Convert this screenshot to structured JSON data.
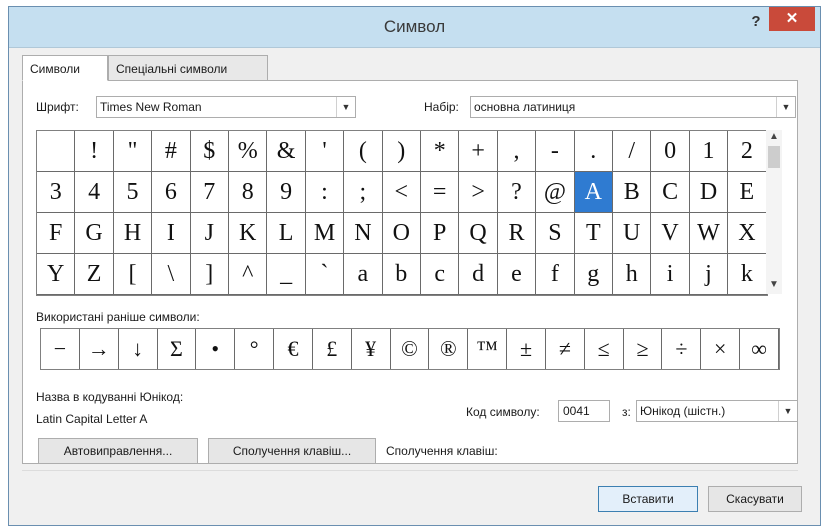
{
  "window": {
    "title": "Символ",
    "help_label": "?",
    "close_label": "✕"
  },
  "tabs": [
    {
      "label": "Символи",
      "active": true
    },
    {
      "label": "Спеціальні символи",
      "active": false
    }
  ],
  "font": {
    "label": "Шрифт:",
    "value": "Times New Roman"
  },
  "subset": {
    "label": "Набір:",
    "value": "основна латиниця"
  },
  "symbol_grid": {
    "rows": [
      [
        " ",
        "!",
        "\"",
        "#",
        "$",
        "%",
        "&",
        "'",
        "(",
        ")",
        "*",
        "+",
        ",",
        "-",
        ".",
        "/",
        "0",
        "1",
        "2"
      ],
      [
        "3",
        "4",
        "5",
        "6",
        "7",
        "8",
        "9",
        ":",
        ";",
        "<",
        "=",
        ">",
        "?",
        "@",
        "A",
        "B",
        "C",
        "D",
        "E"
      ],
      [
        "F",
        "G",
        "H",
        "I",
        "J",
        "K",
        "L",
        "M",
        "N",
        "O",
        "P",
        "Q",
        "R",
        "S",
        "T",
        "U",
        "V",
        "W",
        "X"
      ],
      [
        "Y",
        "Z",
        "[",
        "\\",
        "]",
        "^",
        "_",
        "`",
        "a",
        "b",
        "c",
        "d",
        "e",
        "f",
        "g",
        "h",
        "i",
        "j",
        "k"
      ]
    ],
    "selected": "A"
  },
  "recent": {
    "label": "Використані раніше символи:",
    "symbols": [
      "−",
      "→",
      "↓",
      "Σ",
      "•",
      "°",
      "€",
      "£",
      "¥",
      "©",
      "®",
      "™",
      "±",
      "≠",
      "≤",
      "≥",
      "÷",
      "×",
      "∞"
    ]
  },
  "unicode_name": {
    "label": "Назва в кодуванні Юнікод:",
    "value": "Latin Capital Letter A"
  },
  "char_code": {
    "label": "Код символу:",
    "value": "0041"
  },
  "from": {
    "label": "з:",
    "value": "Юнікод (шістн.)"
  },
  "buttons": {
    "autocorrect": "Автовиправлення...",
    "shortcut_key": "Сполучення клавіш...",
    "shortcut_label": "Сполучення клавіш:",
    "insert": "Вставити",
    "cancel": "Скасувати"
  },
  "colors": {
    "title_bar": "#c5dff0",
    "close_button": "#c94a3a",
    "selection": "#2f7bd1"
  }
}
